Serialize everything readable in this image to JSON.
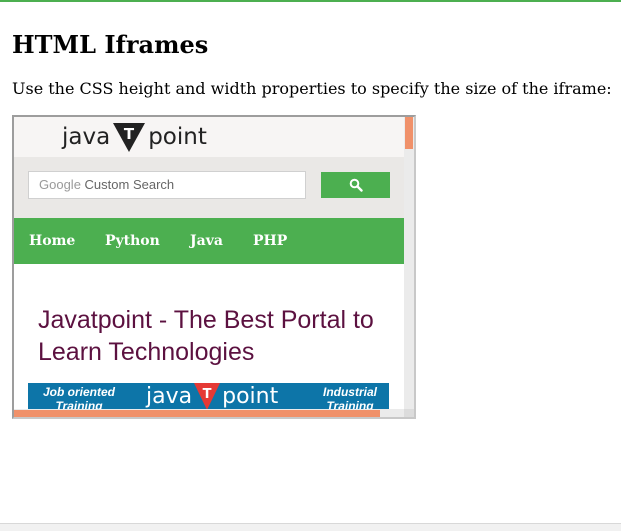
{
  "page": {
    "heading": "HTML Iframes",
    "description": "Use the CSS height and width properties to specify the size of the iframe:"
  },
  "iframe": {
    "logo": {
      "left": "java",
      "mid": "T",
      "right": "point"
    },
    "search": {
      "brand": "Google",
      "placeholder": "Custom Search",
      "button_icon": "search-icon"
    },
    "nav": [
      "Home",
      "Python",
      "Java",
      "PHP"
    ],
    "headline": "Javatpoint - The Best Portal to Learn Technologies",
    "banner": {
      "left": "Job oriented Training",
      "logo_left": "java",
      "logo_mid": "T",
      "logo_right": "point",
      "right": "Industrial Training"
    },
    "scroll": {
      "vertical": 0.0,
      "horizontal": 0.0
    }
  },
  "colors": {
    "accent_green": "#4caf50",
    "headline": "#5c1140",
    "banner_blue": "#0d75a8",
    "scroll_thumb": "#f0916a",
    "logo_red": "#e53935"
  }
}
